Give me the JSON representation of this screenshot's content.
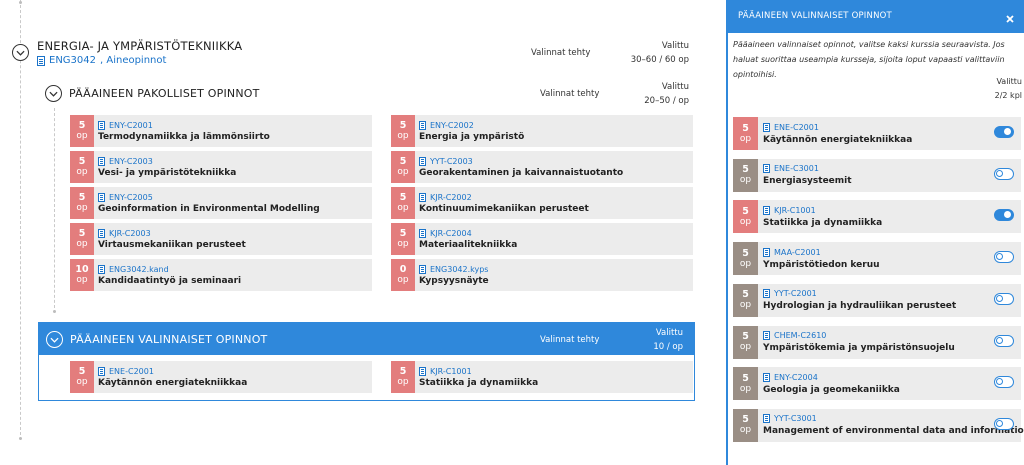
{
  "main": {
    "root": {
      "title": "ENERGIA- JA YMPÄRISTÖTEKNIIKKA",
      "code": "ENG3042",
      "code_suffix": ", Aineopinnot",
      "status": "Valinnat tehty",
      "valittu_label": "Valittu",
      "valittu_value": "30–60 / 60 op"
    },
    "mandatory": {
      "title": "PÄÄAINEEN PAKOLLISET OPINNOT",
      "status": "Valinnat tehty",
      "valittu_label": "Valittu",
      "valittu_value": "20–50 / op",
      "courses": [
        {
          "credits": "5",
          "unit": "op",
          "code": "ENY-C2001",
          "name": "Termodynamiikka ja lämmönsiirto"
        },
        {
          "credits": "5",
          "unit": "op",
          "code": "ENY-C2002",
          "name": "Energia ja ympäristö"
        },
        {
          "credits": "5",
          "unit": "op",
          "code": "ENY-C2003",
          "name": "Vesi- ja ympäristötekniikka"
        },
        {
          "credits": "5",
          "unit": "op",
          "code": "YYT-C2003",
          "name": "Georakentaminen ja kaivannaistuotanto"
        },
        {
          "credits": "5",
          "unit": "op",
          "code": "ENY-C2005",
          "name": "Geoinformation in Environmental Modelling"
        },
        {
          "credits": "5",
          "unit": "op",
          "code": "KJR-C2002",
          "name": "Kontinuumimekaniikan perusteet"
        },
        {
          "credits": "5",
          "unit": "op",
          "code": "KJR-C2003",
          "name": "Virtausmekaniikan perusteet"
        },
        {
          "credits": "5",
          "unit": "op",
          "code": "KJR-C2004",
          "name": "Materiaalitekniikka"
        },
        {
          "credits": "10",
          "unit": "op",
          "code": "ENG3042.kand",
          "name": "Kandidaatintyö ja seminaari"
        },
        {
          "credits": "0",
          "unit": "op",
          "code": "ENG3042.kyps",
          "name": "Kypsyysnäyte"
        }
      ]
    },
    "optional": {
      "title": "PÄÄAINEEN VALINNAISET OPINNOT",
      "status": "Valinnat tehty",
      "valittu_label": "Valittu",
      "valittu_value": "10 / op",
      "courses": [
        {
          "credits": "5",
          "unit": "op",
          "code": "ENE-C2001",
          "name": "Käytännön energiatekniikkaa"
        },
        {
          "credits": "5",
          "unit": "op",
          "code": "KJR-C1001",
          "name": "Statiikka ja dynamiikka"
        }
      ]
    }
  },
  "panel": {
    "title": "PÄÄAINEEN VALINNAISET OPINNOT",
    "description": "Pääaineen valinnaiset opinnot, valitse kaksi kurssia seuraavista. Jos haluat suorittaa useampia kursseja, sijoita loput vapaasti valittaviin opintoihisi.",
    "valittu_label": "Valittu",
    "valittu_value": "2/2 kpl",
    "courses": [
      {
        "credits": "5",
        "unit": "op",
        "code": "ENE-C2001",
        "name": "Käytännön energiatekniikkaa",
        "selected": true
      },
      {
        "credits": "5",
        "unit": "op",
        "code": "ENE-C3001",
        "name": "Energiasysteemit",
        "selected": false
      },
      {
        "credits": "5",
        "unit": "op",
        "code": "KJR-C1001",
        "name": "Statiikka ja dynamiikka",
        "selected": true
      },
      {
        "credits": "5",
        "unit": "op",
        "code": "MAA-C2001",
        "name": "Ympäristötiedon keruu",
        "selected": false
      },
      {
        "credits": "5",
        "unit": "op",
        "code": "YYT-C2001",
        "name": "Hydrologian ja hydrauliikan perusteet",
        "selected": false
      },
      {
        "credits": "5",
        "unit": "op",
        "code": "CHEM-C2610",
        "name": "Ympäristökemia ja ympäristönsuojelu",
        "selected": false
      },
      {
        "credits": "5",
        "unit": "op",
        "code": "ENY-C2004",
        "name": "Geologia ja geomekaniikka",
        "selected": false
      },
      {
        "credits": "5",
        "unit": "op",
        "code": "YYT-C3001",
        "name": "Management of environmental data and information",
        "selected": false
      }
    ]
  },
  "icons": {
    "toggle": "chevron-down-icon",
    "document": "document-icon",
    "close": "close-icon"
  },
  "colors": {
    "accent": "#2f88db",
    "credit_selected": "#e37d7d",
    "credit_unselected": "#9a8e85",
    "card_bg": "#ececec",
    "link": "#1a73c9"
  }
}
